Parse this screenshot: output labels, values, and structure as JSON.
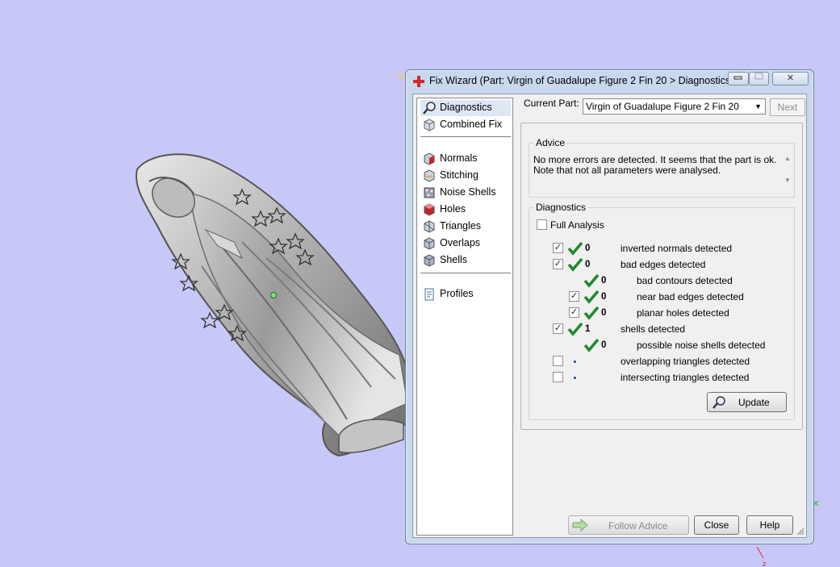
{
  "window": {
    "title": "Fix Wizard (Part: Virgin of Guadalupe Figure 2 Fin 20 > Diagnostics",
    "minimize_symbol": "▭",
    "maximize_symbol": "▭",
    "close_symbol": "✕"
  },
  "nav": {
    "items": [
      {
        "label": "Diagnostics",
        "icon": "magnifier-icon",
        "selected": true
      },
      {
        "label": "Combined Fix",
        "icon": "cube-icon"
      },
      {
        "label": "Normals",
        "icon": "normals-cube-icon"
      },
      {
        "label": "Stitching",
        "icon": "stitching-cube-icon"
      },
      {
        "label": "Noise Shells",
        "icon": "noise-shells-icon"
      },
      {
        "label": "Holes",
        "icon": "holes-cube-icon"
      },
      {
        "label": "Triangles",
        "icon": "triangles-cube-icon"
      },
      {
        "label": "Overlaps",
        "icon": "overlaps-cube-icon"
      },
      {
        "label": "Shells",
        "icon": "shells-cube-icon"
      },
      {
        "label": "Profiles",
        "icon": "document-icon"
      }
    ]
  },
  "current_part": {
    "label": "Current Part:",
    "value": "Virgin of Guadalupe Figure 2 Fin 20",
    "next_label": "Next"
  },
  "advice": {
    "group_label": "Advice",
    "line1": "No more errors are detected. It seems that the part is ok.",
    "line2": "Note that not all parameters were analysed."
  },
  "diagnostics": {
    "group_label": "Diagnostics",
    "full_analysis_label": "Full Analysis",
    "rows": [
      {
        "checked": true,
        "count": "0",
        "label": "inverted normals detected"
      },
      {
        "checked": true,
        "count": "0",
        "label": "bad edges detected"
      },
      {
        "checked": false,
        "count": "0",
        "label": "bad contours detected"
      },
      {
        "checked": true,
        "count": "0",
        "label": "near bad edges detected"
      },
      {
        "checked": true,
        "count": "0",
        "label": "planar holes detected"
      },
      {
        "checked": true,
        "count": "1",
        "label": "shells detected"
      },
      {
        "checked": false,
        "count": "0",
        "label": "possible noise shells detected"
      },
      {
        "checked": false,
        "count": "",
        "label": "overlapping triangles detected"
      },
      {
        "checked": false,
        "count": "",
        "label": "intersecting triangles detected"
      }
    ],
    "update_label": "Update"
  },
  "footer": {
    "follow_advice_label": "Follow Advice",
    "close_label": "Close",
    "help_label": "Help"
  },
  "colors": {
    "viewport_bg": "#c8c8f8",
    "tick_green": "#1e8a2e",
    "title_icon_red": "#d62828"
  }
}
